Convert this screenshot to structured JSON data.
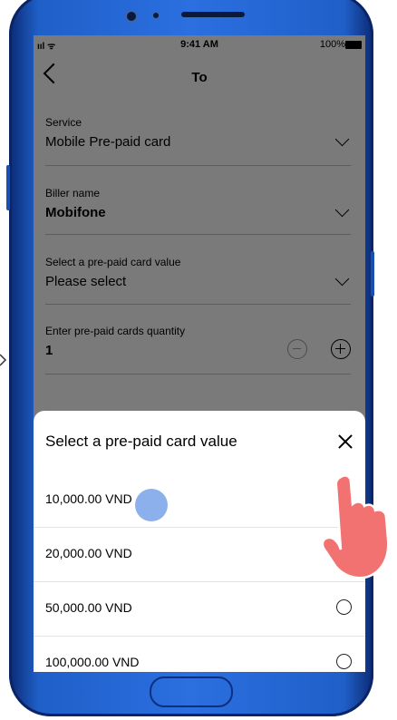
{
  "status_bar": {
    "signal": "ııl ᯤ",
    "time": "9:41 AM",
    "battery": "100%"
  },
  "header": {
    "back_icon": "chevron-left-icon",
    "title": "To"
  },
  "form": {
    "service": {
      "label": "Service",
      "value": "Mobile Pre-paid card"
    },
    "biller": {
      "label": "Biller name",
      "value": "Mobifone"
    },
    "card_value": {
      "label": "Select a pre-paid card value",
      "placeholder": "Please select"
    },
    "quantity": {
      "label": "Enter pre-paid cards quantity",
      "value": "1"
    }
  },
  "sheet": {
    "title": "Select a pre-paid card value",
    "close_icon": "close-icon",
    "options": [
      {
        "label": "10,000.00 VND"
      },
      {
        "label": "20,000.00 VND"
      },
      {
        "label": "50,000.00 VND"
      },
      {
        "label": "100,000.00 VND"
      }
    ]
  }
}
